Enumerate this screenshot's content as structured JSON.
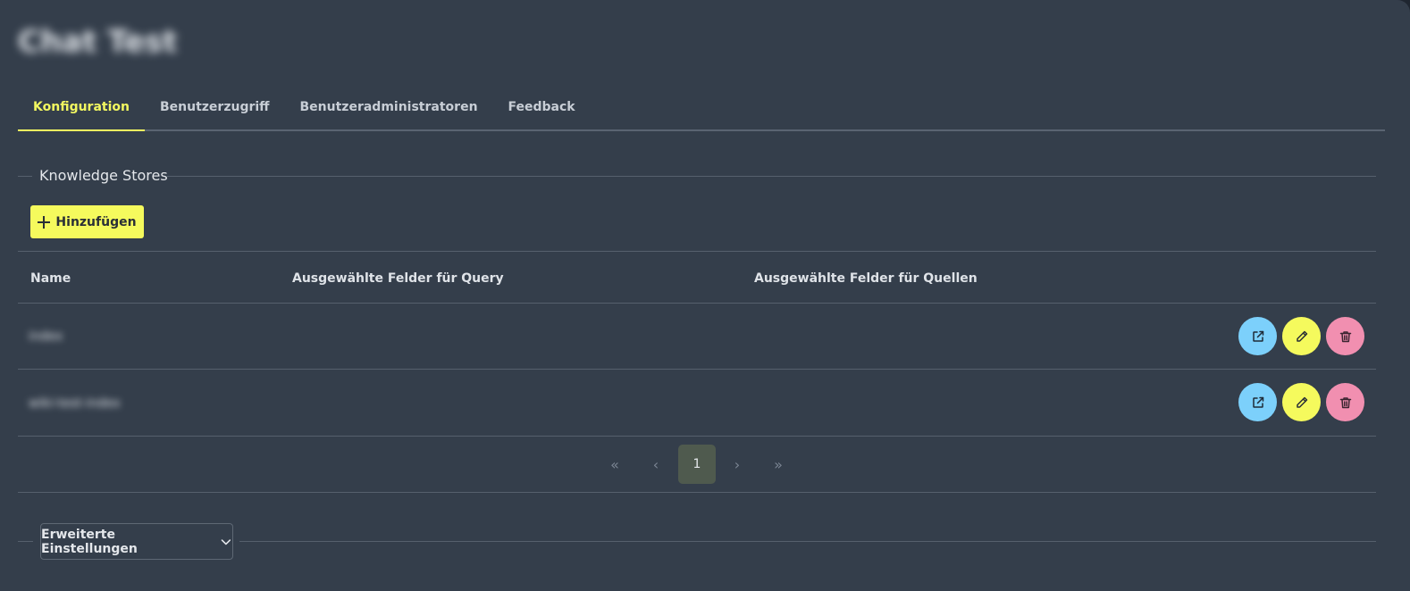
{
  "header": {
    "title": "Chat Test"
  },
  "tabs": [
    {
      "label": "Konfiguration",
      "active": true
    },
    {
      "label": "Benutzerzugriff",
      "active": false
    },
    {
      "label": "Benutzeradministratoren",
      "active": false
    },
    {
      "label": "Feedback",
      "active": false
    }
  ],
  "knowledge_stores": {
    "section_label": "Knowledge Stores",
    "add_label": "Hinzufügen",
    "columns": [
      "Name",
      "Ausgewählte Felder für Query",
      "Ausgewählte Felder für Quellen"
    ],
    "rows": [
      {
        "name": "index"
      },
      {
        "name": "wiki-test-index"
      }
    ]
  },
  "pagination": {
    "first": "«",
    "prev": "‹",
    "current": "1",
    "next": "›",
    "last": "»"
  },
  "advanced": {
    "label": "Erweiterte Einstellungen"
  },
  "icons": {
    "open": "external-link-icon",
    "edit": "pencil-icon",
    "delete": "trash-icon",
    "add": "plus-icon",
    "expand": "chevron-down-icon"
  },
  "colors": {
    "background": "#343e4b",
    "accent": "#f5fa5d",
    "open_button": "#7cd0fb",
    "delete_button": "#f18fb0"
  }
}
